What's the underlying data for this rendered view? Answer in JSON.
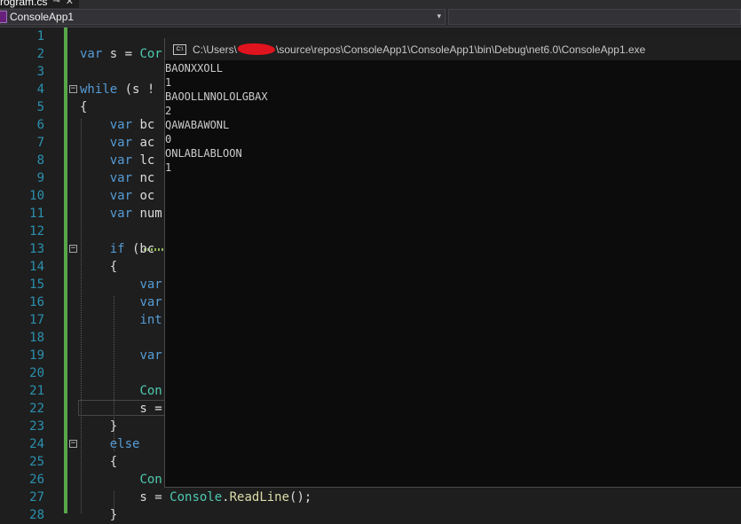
{
  "tab": {
    "label": "rogram.cs",
    "pin": "⊸",
    "close": "✕"
  },
  "nav": {
    "project": "ConsoleApp1",
    "arrow": "▾"
  },
  "editor": {
    "line_numbers": [
      "1",
      "2",
      "3",
      "4",
      "5",
      "6",
      "7",
      "8",
      "9",
      "10",
      "11",
      "12",
      "13",
      "14",
      "15",
      "16",
      "17",
      "18",
      "19",
      "20",
      "21",
      "22",
      "23",
      "24",
      "25",
      "26",
      "27",
      "28"
    ],
    "lines": [
      [],
      [
        {
          "k": "kw",
          "t": "var"
        },
        {
          "k": "p",
          "t": " s = "
        },
        {
          "k": "ty",
          "t": "Cor"
        }
      ],
      [],
      [
        {
          "k": "kw",
          "t": "while"
        },
        {
          "k": "p",
          "t": " (s !"
        }
      ],
      [
        {
          "k": "p",
          "t": "{"
        }
      ],
      [
        {
          "k": "p",
          "t": "    "
        },
        {
          "k": "kw",
          "t": "var"
        },
        {
          "k": "p",
          "t": " bc"
        }
      ],
      [
        {
          "k": "p",
          "t": "    "
        },
        {
          "k": "kw",
          "t": "var"
        },
        {
          "k": "p",
          "t": " ac"
        }
      ],
      [
        {
          "k": "p",
          "t": "    "
        },
        {
          "k": "kw",
          "t": "var"
        },
        {
          "k": "p",
          "t": " lc"
        }
      ],
      [
        {
          "k": "p",
          "t": "    "
        },
        {
          "k": "kw",
          "t": "var"
        },
        {
          "k": "p",
          "t": " nc"
        }
      ],
      [
        {
          "k": "p",
          "t": "    "
        },
        {
          "k": "kw",
          "t": "var"
        },
        {
          "k": "p",
          "t": " oc"
        }
      ],
      [
        {
          "k": "p",
          "t": "    "
        },
        {
          "k": "kw",
          "t": "var"
        },
        {
          "k": "p",
          "t": " num"
        }
      ],
      [],
      [
        {
          "k": "p",
          "t": "    "
        },
        {
          "k": "kw",
          "t": "if"
        },
        {
          "k": "p",
          "t": " (bc"
        }
      ],
      [
        {
          "k": "p",
          "t": "    {"
        }
      ],
      [
        {
          "k": "p",
          "t": "        "
        },
        {
          "k": "kw",
          "t": "var"
        }
      ],
      [
        {
          "k": "p",
          "t": "        "
        },
        {
          "k": "kw",
          "t": "var"
        }
      ],
      [
        {
          "k": "p",
          "t": "        "
        },
        {
          "k": "kw",
          "t": "int"
        }
      ],
      [],
      [
        {
          "k": "p",
          "t": "        "
        },
        {
          "k": "kw",
          "t": "var"
        }
      ],
      [],
      [
        {
          "k": "p",
          "t": "        "
        },
        {
          "k": "ty",
          "t": "Con"
        }
      ],
      [
        {
          "k": "p",
          "t": "        s ="
        }
      ],
      [
        {
          "k": "p",
          "t": "    }"
        }
      ],
      [
        {
          "k": "p",
          "t": "    "
        },
        {
          "k": "kw",
          "t": "else"
        }
      ],
      [
        {
          "k": "p",
          "t": "    {"
        }
      ],
      [
        {
          "k": "p",
          "t": "        "
        },
        {
          "k": "ty",
          "t": "Con"
        }
      ],
      [
        {
          "k": "p",
          "t": "        s = "
        },
        {
          "k": "ty",
          "t": "Console"
        },
        {
          "k": "p",
          "t": "."
        },
        {
          "k": "fn",
          "t": "ReadLine"
        },
        {
          "k": "p",
          "t": "();"
        }
      ],
      [
        {
          "k": "p",
          "t": "    }"
        }
      ]
    ],
    "fold_minus": "−"
  },
  "console": {
    "icon_label": "C:\\",
    "title_prefix": "C:\\Users\\",
    "title_suffix": "\\source\\repos\\ConsoleApp1\\ConsoleApp1\\bin\\Debug\\net6.0\\ConsoleApp1.exe",
    "output": [
      "BAONXXOLL",
      "1",
      "BAOOLLNNOLOLGBAX",
      "2",
      "QAWABAWONL",
      "0",
      "ONLABLABLOON",
      "1"
    ]
  }
}
